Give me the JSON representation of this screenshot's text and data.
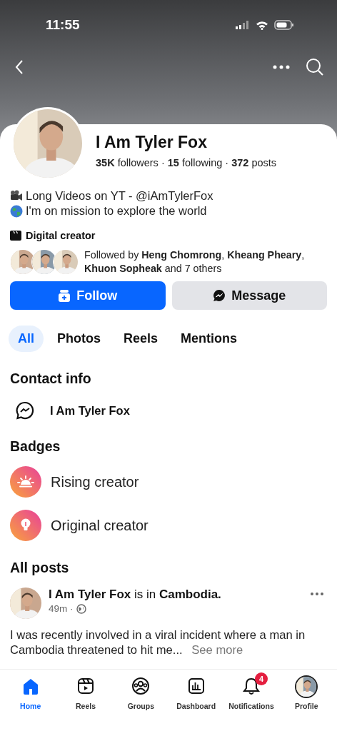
{
  "status_bar": {
    "time": "11:55"
  },
  "profile": {
    "name": "I Am Tyler Fox",
    "stats": "**35K** followers · **15** following · **372** posts"
  },
  "bio": [
    {
      "kind": "camera",
      "text": "Long Videos on YT - @iAmTylerFox"
    },
    {
      "kind": "globe",
      "text": "I'm on mission to explore the world"
    }
  ],
  "category": "Digital creator",
  "followed_by": "Followed by **Heng Chomrong**, **Kheang Pheary**, **Khuon Sopheak** and 7 others",
  "buttons": [
    {
      "kind": "follow",
      "label": "Follow"
    },
    {
      "kind": "message",
      "label": "Message"
    }
  ],
  "tabs": [
    {
      "label": "All",
      "selected": true
    },
    {
      "label": "Photos",
      "selected": false
    },
    {
      "label": "Reels",
      "selected": false
    },
    {
      "label": "Mentions",
      "selected": false
    }
  ],
  "contact_info": {
    "title": "Contact info",
    "items": [
      {
        "kind": "messenger",
        "text": "I Am Tyler Fox"
      }
    ]
  },
  "badges": {
    "title": "Badges",
    "items": [
      {
        "kind": "rising",
        "label": "Rising creator"
      },
      {
        "kind": "original",
        "label": "Original creator"
      }
    ]
  },
  "all_posts": {
    "title": "All posts",
    "post": {
      "header": "**I Am Tyler Fox** is in **Cambodia.**",
      "time": "49m ·",
      "text": "I was recently involved in a viral incident where a man in Cambodia threatened to hit me...",
      "see_more": "See more"
    }
  },
  "nav": [
    {
      "kind": "home",
      "label": "Home",
      "selected": true
    },
    {
      "kind": "reels",
      "label": "Reels",
      "selected": false
    },
    {
      "kind": "groups",
      "label": "Groups",
      "selected": false
    },
    {
      "kind": "dashboard",
      "label": "Dashboard",
      "selected": false
    },
    {
      "kind": "notifications",
      "label": "Notifications",
      "selected": false,
      "badge": "4"
    },
    {
      "kind": "profile",
      "label": "Profile",
      "selected": false
    }
  ]
}
